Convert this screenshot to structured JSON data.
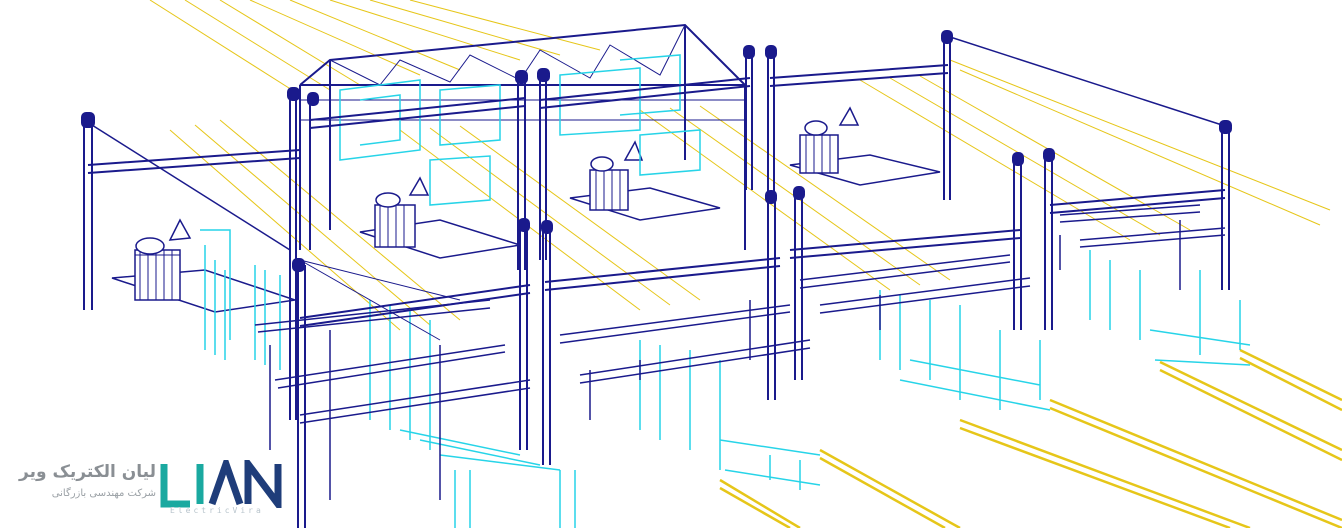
{
  "colors": {
    "structure": "#1a1a8c",
    "equipment": "#27d4e8",
    "cable": "#e6c619",
    "logo_teal": "#1aa9a0",
    "logo_navy": "#1f3d7a"
  },
  "logo": {
    "mark": "LIAN",
    "subtitle": "ElectricVira",
    "company_fa": "لیان الکتریک ویر",
    "tagline_fa": "شرکت مهندسی بازرگانی"
  }
}
